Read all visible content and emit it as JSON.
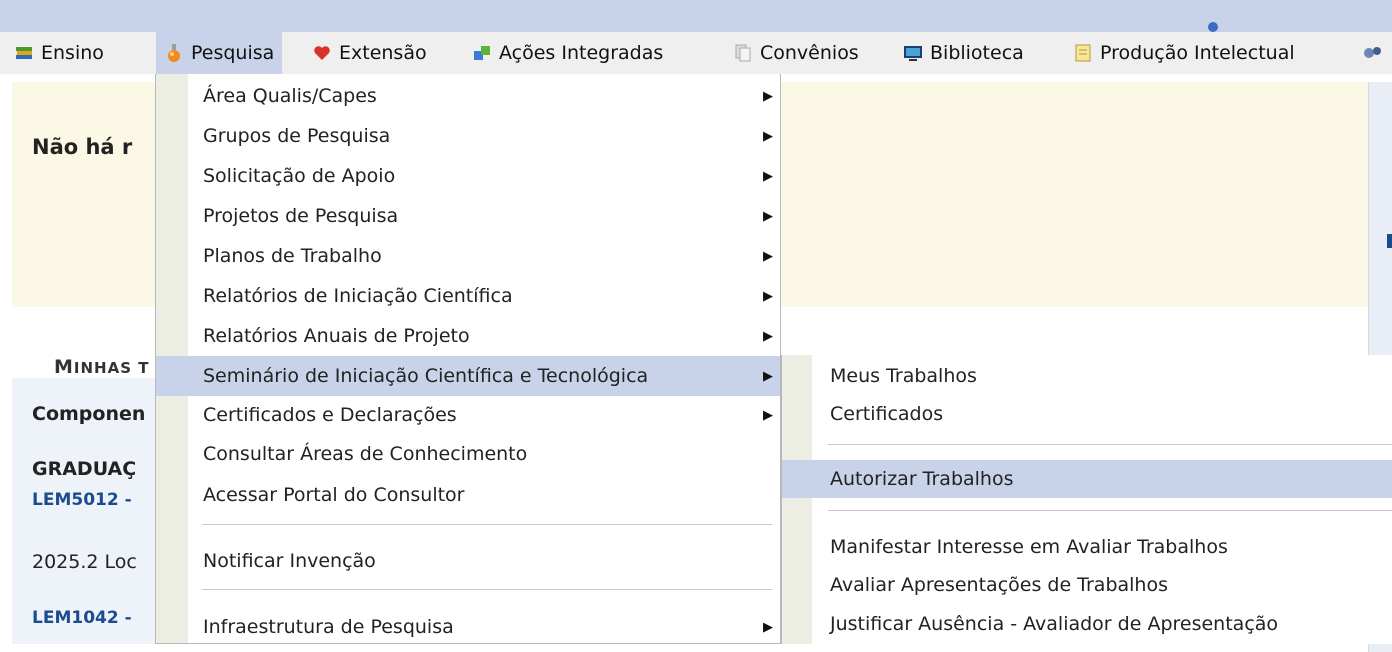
{
  "menubar": {
    "items": [
      {
        "label": "Ensino",
        "icon": "books-icon"
      },
      {
        "label": "Pesquisa",
        "icon": "flask-icon"
      },
      {
        "label": "Extensão",
        "icon": "heart-icon"
      },
      {
        "label": "Ações Integradas",
        "icon": "puzzle-icon"
      },
      {
        "label": "Convênios",
        "icon": "documents-icon"
      },
      {
        "label": "Biblioteca",
        "icon": "monitor-icon"
      },
      {
        "label": "Produção Intelectual",
        "icon": "notepad-icon"
      }
    ]
  },
  "page": {
    "notice_text": "Não há r",
    "tabs_label_first": "M",
    "tabs_label_rest": "INHAS T",
    "componentes_label": "Componen",
    "graduacao_label": "GRADUAÇ",
    "course1": "LEM5012 -",
    "local_text": "2025.2 Loc",
    "course2": "LEM1042 -"
  },
  "pesquisa_menu": {
    "items": [
      {
        "label": "Área Qualis/Capes",
        "submenu": true
      },
      {
        "label": "Grupos de Pesquisa",
        "submenu": true
      },
      {
        "label": "Solicitação de Apoio",
        "submenu": true
      },
      {
        "label": "Projetos de Pesquisa",
        "submenu": true
      },
      {
        "label": "Planos de Trabalho",
        "submenu": true
      },
      {
        "label": "Relatórios de Iniciação Científica",
        "submenu": true
      },
      {
        "label": "Relatórios Anuais de Projeto",
        "submenu": true
      },
      {
        "label": "Seminário de Iniciação Científica e Tecnológica",
        "submenu": true,
        "highlighted": true
      },
      {
        "label": "Certificados e Declarações",
        "submenu": true
      },
      {
        "label": "Consultar Áreas de Conhecimento",
        "submenu": false
      },
      {
        "label": "Acessar Portal do Consultor",
        "submenu": false
      },
      {
        "label": "Notificar Invenção",
        "submenu": false
      },
      {
        "label": "Infraestrutura de Pesquisa",
        "submenu": true
      }
    ]
  },
  "seminario_submenu": {
    "items": [
      {
        "label": "Meus Trabalhos"
      },
      {
        "label": "Certificados"
      },
      {
        "label": "Autorizar Trabalhos",
        "highlighted": true
      },
      {
        "label": "Manifestar Interesse em Avaliar Trabalhos"
      },
      {
        "label": "Avaliar Apresentações de Trabalhos"
      },
      {
        "label": "Justificar Ausência - Avaliador de Apresentação"
      }
    ]
  },
  "colors": {
    "highlight": "#c8d3ea",
    "link": "#1b4c8f",
    "notice_bg": "#fbf8e6"
  }
}
